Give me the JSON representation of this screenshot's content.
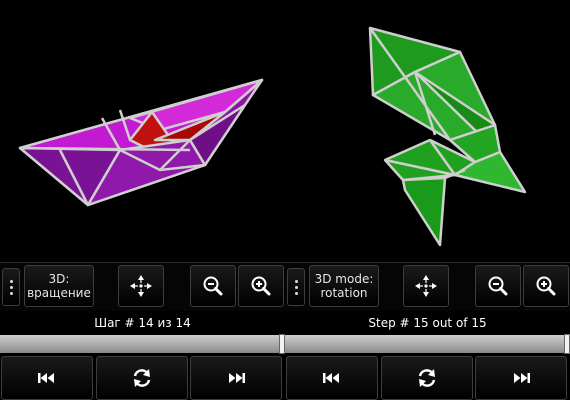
{
  "left": {
    "mode_label": "3D:\nвращение",
    "mode_line1": "3D:",
    "mode_line2": "вращение",
    "step_text": "Шаг # 14 из 14",
    "progress": 1.0
  },
  "right": {
    "mode_line1": "3D mode:",
    "mode_line2": "rotation",
    "step_text": "Step # 15 out of 15",
    "progress": 1.0
  },
  "icons": {
    "menu": "overflow-menu-icon",
    "center": "center-move-icon",
    "zoom_out": "zoom-out-icon",
    "zoom_in": "zoom-in-icon",
    "first": "skip-to-first-icon",
    "replay": "replay-icon",
    "last": "skip-to-last-icon"
  },
  "colors": {
    "boat": "#9a1ab0",
    "boat_inner": "#d11ad1",
    "boat_core": "#c81010",
    "crane": "#1fa01f",
    "crane_light": "#3cc23c",
    "edge": "#cfcfcf"
  }
}
